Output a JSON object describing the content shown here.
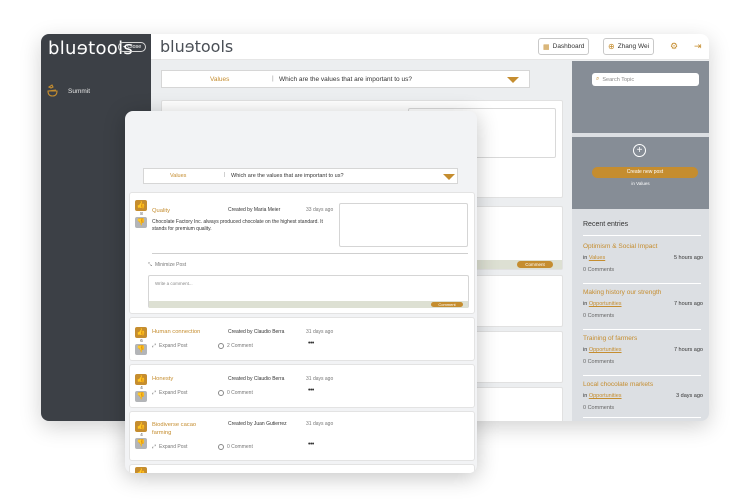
{
  "sidebar": {
    "logo": "bluɘtools",
    "close_label": "Close",
    "items": [
      {
        "label": "Summit",
        "icon": "mountain-icon"
      }
    ]
  },
  "topbar": {
    "logo": "bluɘtools",
    "dashboard_label": "Dashboard",
    "user_name": "Zhang Wei"
  },
  "filter": {
    "category": "Values",
    "question": "Which are the values that are important to us?"
  },
  "right_panel": {
    "search_placeholder": "Search Topic",
    "create_label": "Create new post",
    "create_sub": "in Values",
    "recent_title": "Recent entries",
    "entries": [
      {
        "title": "Optimism & Social Impact",
        "prefix": "in",
        "category": "Values",
        "time": "5 hours ago",
        "comments": "0 Comments"
      },
      {
        "title": "Making history our strength",
        "prefix": "in",
        "category": "Opportunities",
        "time": "7 hours ago",
        "comments": "0 Comments"
      },
      {
        "title": "Training of farmers",
        "prefix": "in",
        "category": "Opportunities",
        "time": "7 hours ago",
        "comments": "0 Comments"
      },
      {
        "title": "Local chocolate markets",
        "prefix": "in",
        "category": "Opportunities",
        "time": "3 days ago",
        "comments": "0 Comments"
      }
    ]
  },
  "posts": {
    "expanded": {
      "title": "Quality",
      "votes": "8",
      "author": "Created by Maria Meier",
      "time": "33 days ago",
      "body": "Chocolate Factory Inc. always produced chocolate on the highest standard. It stands for premium quality.",
      "minimize_label": "Minimize Post",
      "comment_placeholder": "Write a comment...",
      "comment_button": "Comment"
    },
    "collapsed": [
      {
        "title": "Human connection",
        "votes": "6",
        "author": "Created by Claudio Berra",
        "time": "31 days ago",
        "expand_label": "Expand Post",
        "comments": "2 Comment"
      },
      {
        "title": "Honesty",
        "votes": "4",
        "author": "Created by Claudio Berra",
        "time": "31 days ago",
        "expand_label": "Expand Post",
        "comments": "0 Comment"
      },
      {
        "title": "Biodiverse cacao farming",
        "votes": "4",
        "author": "Created by Juan Gutierrez",
        "time": "31 days ago",
        "expand_label": "Expand Post",
        "comments": "0 Comment"
      }
    ]
  },
  "background": {
    "comment_button": "Comment"
  },
  "colors": {
    "accent": "#c58d2f",
    "sidebar": "#3c4046",
    "panel": "#868d96"
  }
}
